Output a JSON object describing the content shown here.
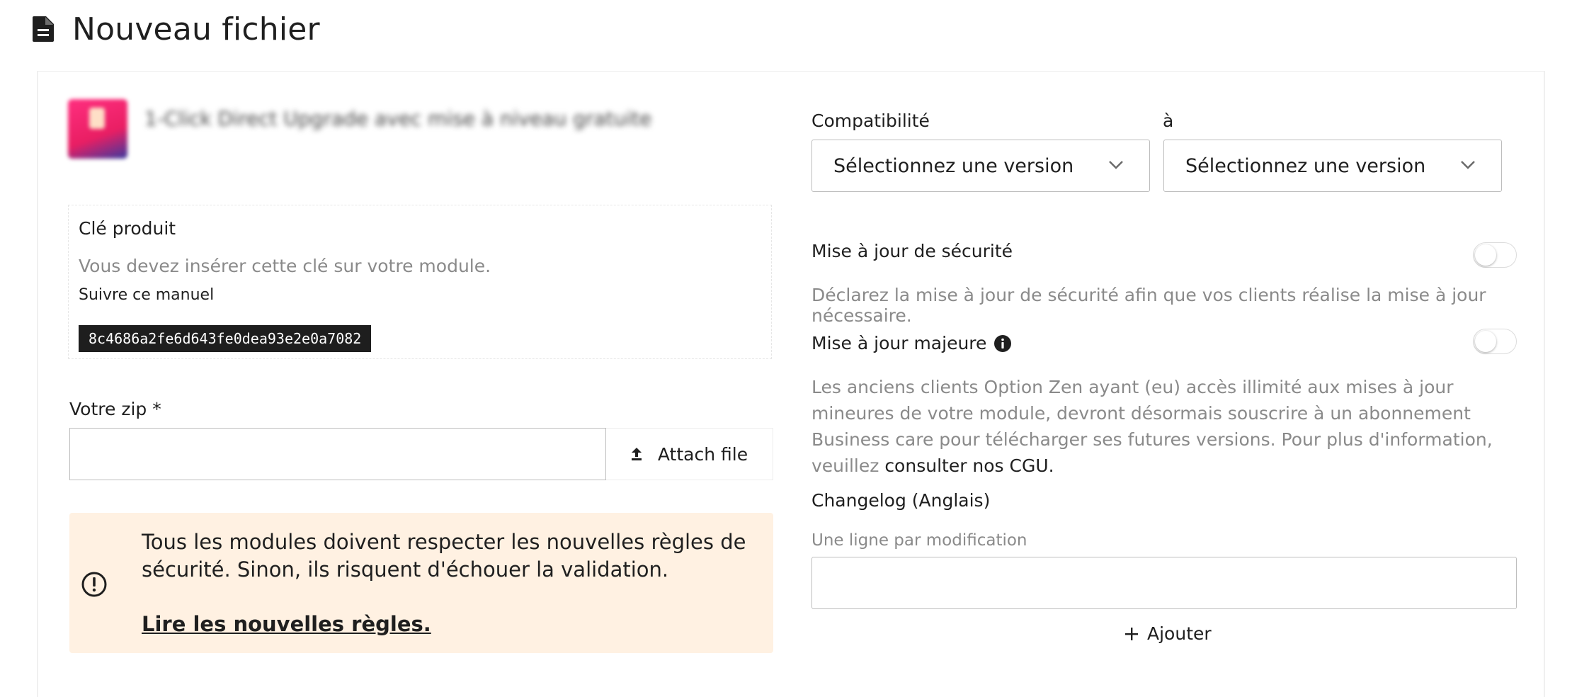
{
  "header": {
    "title": "Nouveau fichier",
    "icon": "document-icon"
  },
  "product": {
    "name": "1-Click Direct Upgrade avec mise à niveau gratuite"
  },
  "key_box": {
    "title": "Clé produit",
    "help": "Vous devez insérer cette clé sur votre module.",
    "manual": "Suivre ce manuel",
    "key": "8c4686a2fe6d643fe0dea93e2e0a7082"
  },
  "zip": {
    "label": "Votre zip *",
    "value": "",
    "attach_label": "Attach file"
  },
  "notice": {
    "text": "Tous les modules doivent respecter les nouvelles règles de sécurité. Sinon, ils risquent d'échouer la validation.",
    "link": "Lire les nouvelles règles.",
    "background": "#fff1e2"
  },
  "compat": {
    "label": "Compatibilité",
    "to_label": "à",
    "from_value": "Sélectionnez une version",
    "to_value": "Sélectionnez une version"
  },
  "security": {
    "label": "Mise à jour de sécurité",
    "desc": "Déclarez la mise à jour de sécurité afin que vos clients réalise la mise à jour nécessaire.",
    "enabled": false
  },
  "major": {
    "label": "Mise à jour majeure",
    "desc": "Les anciens clients Option Zen ayant (eu) accès illimité aux mises à jour mineures de votre module, devront désormais souscrire à un abonnement Business care pour télécharger ses futures versions. Pour plus d'information, veuillez ",
    "link": "consulter nos CGU.",
    "enabled": false
  },
  "changelog": {
    "label": "Changelog (Anglais)",
    "hint": "Une ligne par modification",
    "value": "",
    "add_label": "Ajouter"
  }
}
